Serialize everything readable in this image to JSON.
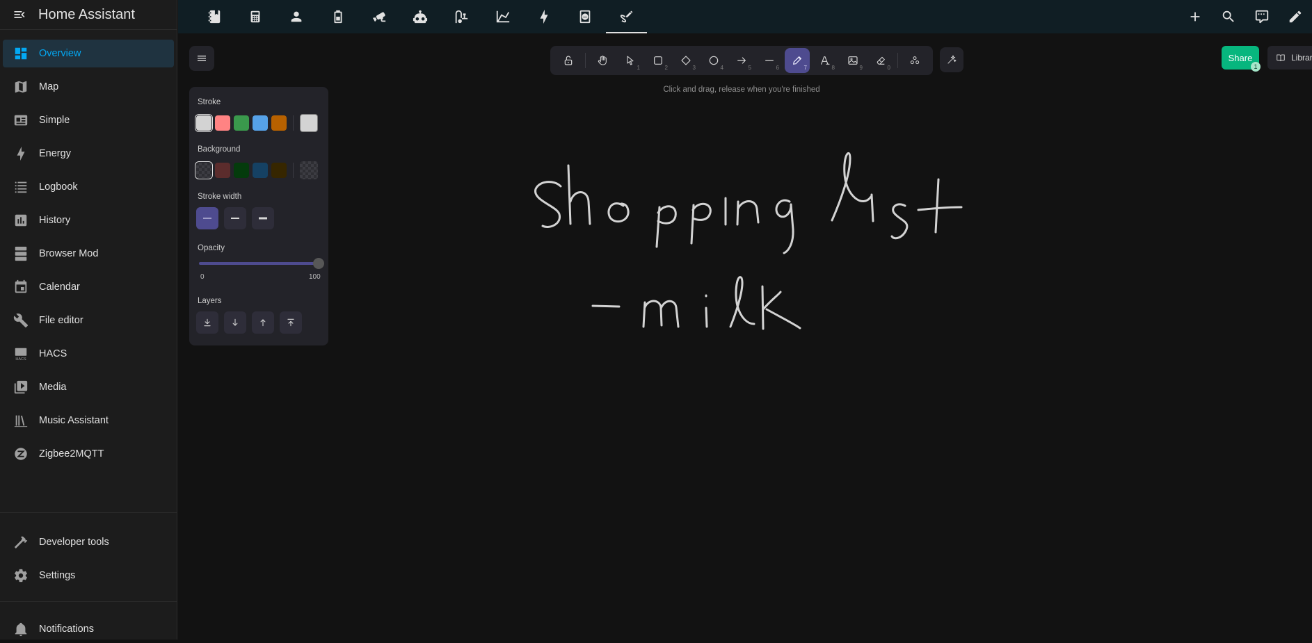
{
  "app": {
    "title": "Home Assistant"
  },
  "sidebar": {
    "items": [
      {
        "label": "Overview",
        "icon": "dashboard-icon",
        "active": true
      },
      {
        "label": "Map",
        "icon": "map-icon"
      },
      {
        "label": "Simple",
        "icon": "card-icon"
      },
      {
        "label": "Energy",
        "icon": "lightning-icon"
      },
      {
        "label": "Logbook",
        "icon": "list-icon"
      },
      {
        "label": "History",
        "icon": "chart-bar-icon"
      },
      {
        "label": "Browser Mod",
        "icon": "server-icon"
      },
      {
        "label": "Calendar",
        "icon": "calendar-icon"
      },
      {
        "label": "File editor",
        "icon": "wrench-icon"
      },
      {
        "label": "HACS",
        "icon": "hacs-icon"
      },
      {
        "label": "Media",
        "icon": "media-icon"
      },
      {
        "label": "Music Assistant",
        "icon": "library-icon"
      },
      {
        "label": "Zigbee2MQTT",
        "icon": "zigbee-icon"
      }
    ],
    "bottom": [
      {
        "label": "Developer tools",
        "icon": "hammer-icon"
      },
      {
        "label": "Settings",
        "icon": "gear-icon"
      },
      {
        "label": "Notifications",
        "icon": "bell-icon"
      }
    ]
  },
  "topbar": {
    "tabs": [
      "notebook-icon",
      "remote-icon",
      "person-icon",
      "battery-icon",
      "cctv-icon",
      "robot-icon",
      "vacuum-icon",
      "chart-line-icon",
      "lightning-icon",
      "dishwasher-icon",
      "draw-icon"
    ],
    "active_tab": 10,
    "actions": [
      "plus-icon",
      "search-icon",
      "assist-icon",
      "pencil-icon"
    ]
  },
  "excalidraw": {
    "toolbar": {
      "tools": [
        {
          "name": "lock",
          "num": ""
        },
        {
          "name": "hand",
          "num": ""
        },
        {
          "name": "selection",
          "num": "1"
        },
        {
          "name": "rectangle",
          "num": "2"
        },
        {
          "name": "diamond",
          "num": "3"
        },
        {
          "name": "ellipse",
          "num": "4"
        },
        {
          "name": "arrow",
          "num": "5"
        },
        {
          "name": "line",
          "num": "6"
        },
        {
          "name": "draw",
          "num": "7",
          "active": true
        },
        {
          "name": "text",
          "num": "8"
        },
        {
          "name": "image",
          "num": "9"
        },
        {
          "name": "eraser",
          "num": "0"
        },
        {
          "name": "more-tools",
          "num": ""
        }
      ]
    },
    "hint": "Click and drag, release when you're finished",
    "share": {
      "label": "Share",
      "badge": "1"
    },
    "library": {
      "label": "Library"
    },
    "properties": {
      "stroke_label": "Stroke",
      "stroke_colors": [
        "#d3d3d3",
        "#ff8383",
        "#3a994c",
        "#56a2e8",
        "#b76100"
      ],
      "stroke_current": "#d3d3d3",
      "background_label": "Background",
      "background_colors": [
        "transparent",
        "#5b2c2c",
        "#043b0c",
        "#154163",
        "#362600"
      ],
      "stroke_width_label": "Stroke width",
      "opacity_label": "Opacity",
      "opacity_value": 100,
      "opacity_min": "0",
      "opacity_max": "100",
      "layers_label": "Layers"
    },
    "canvas_text": [
      "Shopping list",
      "-milk"
    ]
  }
}
